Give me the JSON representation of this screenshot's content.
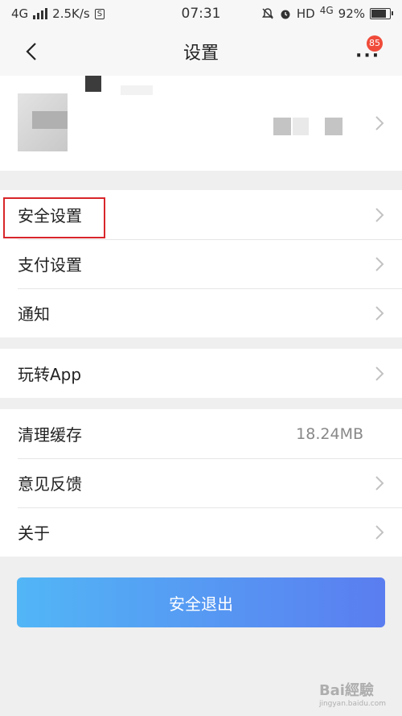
{
  "status_bar": {
    "network_left": "4G",
    "speed": "2.5K/s",
    "s_badge": "S",
    "time": "07:31",
    "hd": "HD",
    "network_right": "4G",
    "battery": "92%"
  },
  "nav": {
    "title": "设置",
    "badge": "85",
    "more_label": "···"
  },
  "groups": [
    {
      "items": [
        {
          "label": "安全设置"
        },
        {
          "label": "支付设置"
        },
        {
          "label": "通知"
        }
      ]
    },
    {
      "items": [
        {
          "label": "玩转App"
        }
      ]
    },
    {
      "items": [
        {
          "label": "清理缓存",
          "value": "18.24MB"
        },
        {
          "label": "意见反馈"
        },
        {
          "label": "关于"
        }
      ]
    }
  ],
  "logout_label": "安全退出",
  "watermark": {
    "brand": "Bai經驗",
    "url": "jingyan.baidu.com"
  },
  "colors": {
    "highlight": "#d8262b",
    "badge": "#f04b3a",
    "button_start": "#52b6f6",
    "button_end": "#5a7df0"
  }
}
